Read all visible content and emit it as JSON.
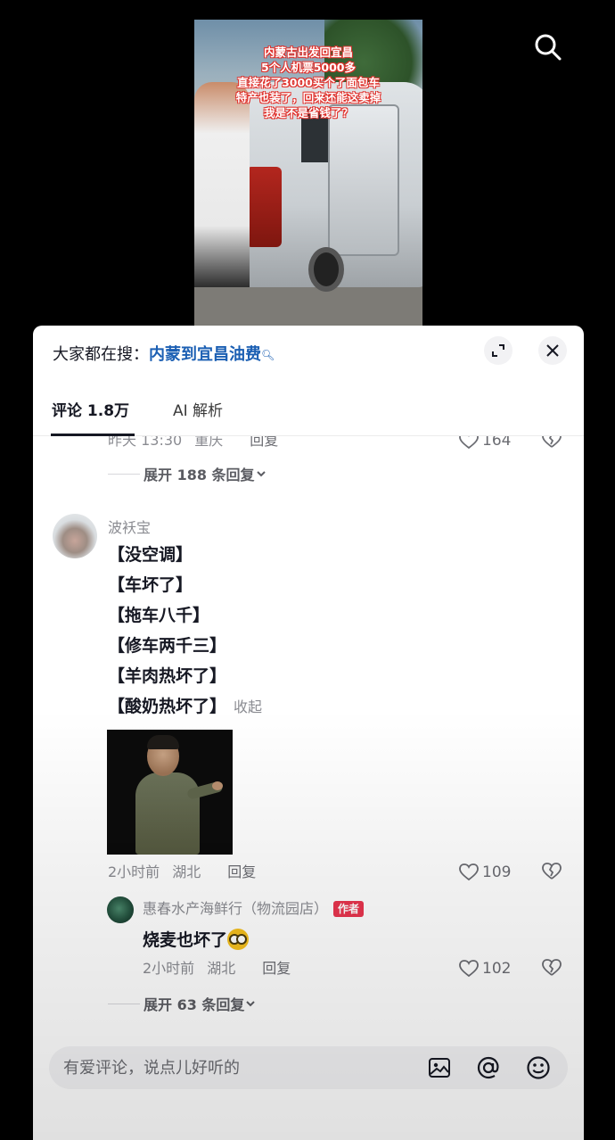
{
  "video": {
    "overlay_lines": [
      "内蒙古出发回宜昌",
      "5个人机票5000多",
      "直接花了3000买个了面包车",
      "特产也装了，回来还能这卖掉",
      "我是不是省钱了？"
    ]
  },
  "hot_search": {
    "label": "大家都在搜：",
    "term": "内蒙到宜昌油费",
    "icons": [
      "search-icon",
      "expand-icon",
      "close-icon"
    ]
  },
  "tabs": [
    {
      "label": "评论 1.8万",
      "active": true
    },
    {
      "label": "AI 解析",
      "active": false
    }
  ],
  "prev_comment": {
    "time": "昨天 13:30",
    "location": "重庆",
    "reply_label": "回复",
    "likes": "164",
    "expand_label": "展开 188 条回复"
  },
  "comment": {
    "username": "波袄宝",
    "lines": [
      "【没空调】",
      "【车坏了】",
      "【拖车八千】",
      "【修车两千三】",
      "【羊肉热坏了】",
      "【酸奶热坏了】"
    ],
    "collapse_label": "收起",
    "time": "2小时前",
    "location": "湖北",
    "reply_label": "回复",
    "likes": "109"
  },
  "reply": {
    "username": "惠春水产海鲜行（物流园店）",
    "badge": "作者",
    "text": "烧麦也坏了",
    "time": "2小时前",
    "location": "湖北",
    "reply_label": "回复",
    "likes": "102",
    "expand_label": "展开 63 条回复"
  },
  "input": {
    "placeholder": "有爱评论，说点儿好听的"
  },
  "colors": {
    "link_blue": "#1b5fb3",
    "author_badge": "#e8344e"
  }
}
